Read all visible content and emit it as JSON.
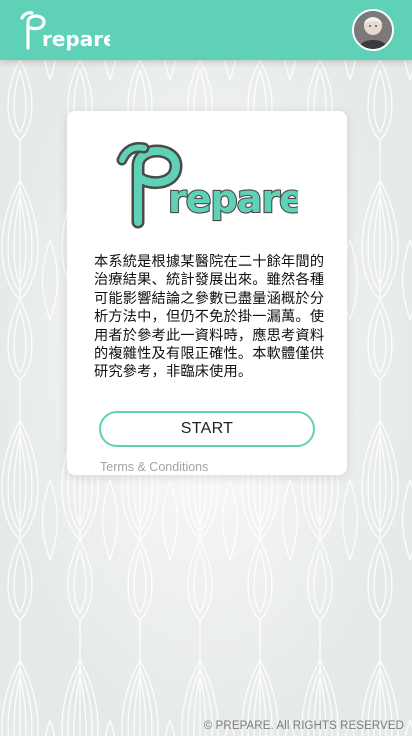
{
  "header": {
    "logo_text": "Prepare",
    "avatar_icon": "user-avatar",
    "background_color": "#5fd1b6"
  },
  "card": {
    "logo_text": "Prepare",
    "disclaimer": "本系統是根據某醫院在二十餘年間的治療結果、統計發展出來。雖然各種可能影響結論之參數已盡量涵概於分析方法中，但仍不免於掛一漏萬。使用者於參考此一資料時，應思考資料的複雜性及有限正確性。本軟體僅供研究參考，非臨床使用。",
    "start_label": "START",
    "terms_label": "Terms & Conditions"
  },
  "footer": {
    "copyright": "© PREPARE. All RIGHTS RESERVED"
  },
  "colors": {
    "accent": "#5fd1b6",
    "logo_outline": "#4a4a4a",
    "background": "#e9ecec"
  }
}
